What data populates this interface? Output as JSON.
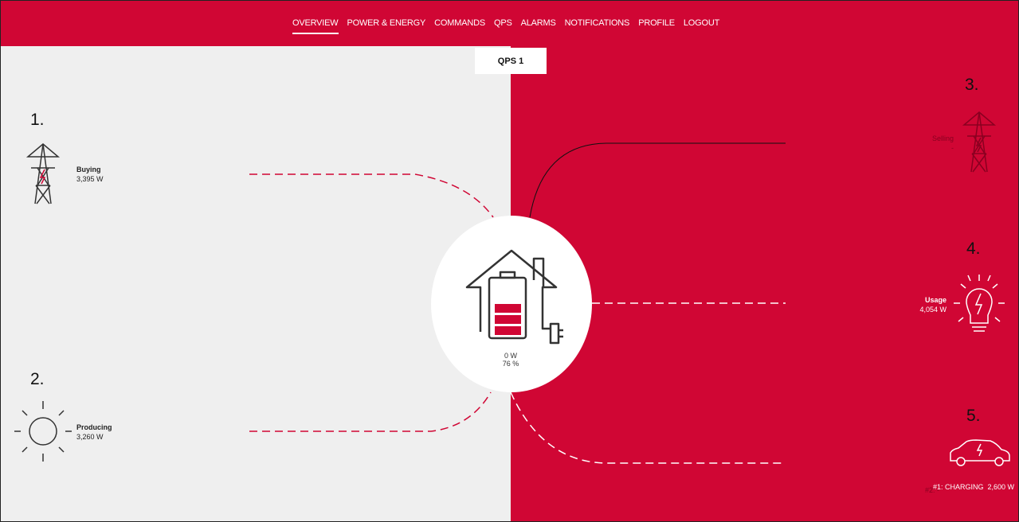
{
  "nav": {
    "items": [
      {
        "label": "OVERVIEW",
        "active": true
      },
      {
        "label": "POWER & ENERGY"
      },
      {
        "label": "COMMANDS"
      },
      {
        "label": "QPS"
      },
      {
        "label": "ALARMS"
      },
      {
        "label": "NOTIFICATIONS"
      },
      {
        "label": "PROFILE"
      },
      {
        "label": "LOGOUT"
      }
    ]
  },
  "device_tab": "QPS 1",
  "callouts": [
    "1.",
    "2.",
    "3.",
    "4.",
    "5."
  ],
  "grid_buy": {
    "title": "Buying",
    "value": "3,395 W",
    "icon": "power-tower-icon"
  },
  "solar": {
    "title": "Producing",
    "value": "3,260 W",
    "icon": "sun-icon"
  },
  "grid_sell": {
    "title": "Selling",
    "value": "-",
    "icon": "power-tower-icon"
  },
  "usage": {
    "title": "Usage",
    "value": "4,054 W",
    "icon": "lightbulb-icon"
  },
  "ev": {
    "line1": "#1: CHARGING  2,600 W",
    "line2": "#2: -",
    "icon": "electric-car-icon"
  },
  "battery": {
    "power": "0 W",
    "soc": "76 %",
    "icon": "house-battery-icon"
  },
  "colors": {
    "brand": "#d00634",
    "panel_light": "#efefef"
  }
}
